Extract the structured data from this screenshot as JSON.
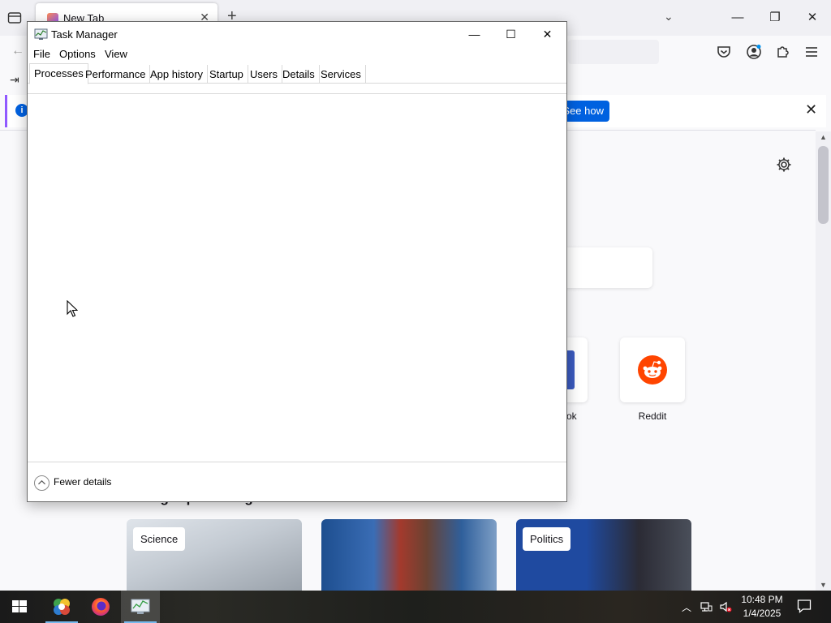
{
  "firefox": {
    "tab_title": "New Tab",
    "info_bar_button": "See how",
    "shortcuts": [
      {
        "label": "Facebook"
      },
      {
        "label": "Reddit"
      }
    ],
    "stories_heading": "Thought-provoking stories",
    "stories": [
      {
        "tag": "Science"
      },
      {
        "tag": ""
      },
      {
        "tag": "Politics"
      }
    ]
  },
  "task_manager": {
    "title": "Task Manager",
    "menu": [
      "File",
      "Options",
      "View"
    ],
    "tabs": [
      {
        "label": "Processes",
        "active": true
      },
      {
        "label": "Performance",
        "active": false
      },
      {
        "label": "App history",
        "active": false
      },
      {
        "label": "Startup",
        "active": false
      },
      {
        "label": "Users",
        "active": false
      },
      {
        "label": "Details",
        "active": false
      },
      {
        "label": "Services",
        "active": false
      }
    ],
    "footer_label": "Fewer details"
  },
  "taskbar": {
    "clock_time": "10:48 PM",
    "clock_date": "1/4/2025",
    "apps": [
      "start-icon",
      "app-icon",
      "firefox-icon",
      "task-manager-icon"
    ],
    "accent_color": "#76b9ed"
  },
  "colors": {
    "firefox_blue": "#0061e0",
    "reddit_orange": "#ff4500"
  }
}
